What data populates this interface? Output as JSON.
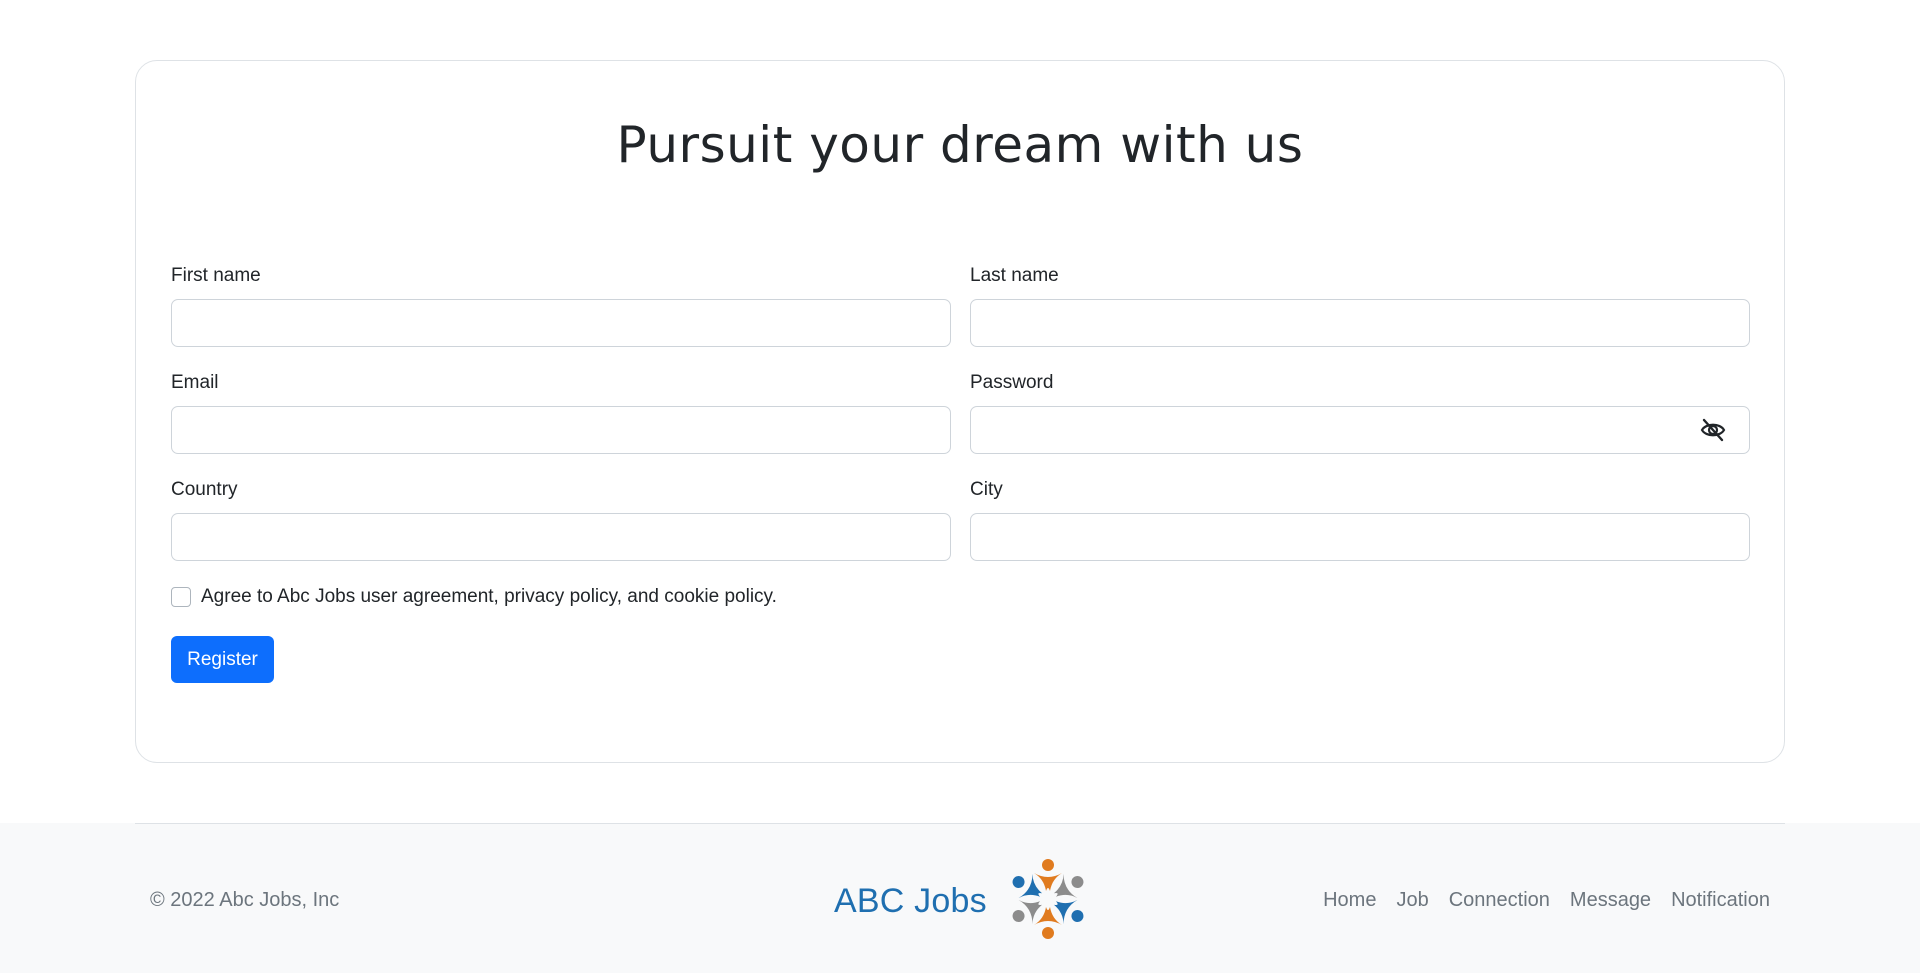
{
  "header": {
    "title": "Pursuit your dream with us"
  },
  "form": {
    "first_name_label": "First name",
    "last_name_label": "Last name",
    "email_label": "Email",
    "password_label": "Password",
    "country_label": "Country",
    "city_label": "City",
    "first_name_value": "",
    "last_name_value": "",
    "email_value": "",
    "password_value": "",
    "country_value": "",
    "city_value": "",
    "agree_label": "Agree to Abc Jobs user agreement, privacy policy, and cookie policy.",
    "agree_checked": false,
    "register_label": "Register",
    "password_toggle_icon": "eye-slash-icon"
  },
  "footer": {
    "copyright": "© 2022 Abc Jobs, Inc",
    "brand_text": "ABC Jobs",
    "brand_colors": [
      "#1f6fb0",
      "#e07b1f",
      "#8c8c8c"
    ],
    "nav": [
      "Home",
      "Job",
      "Connection",
      "Message",
      "Notification"
    ]
  },
  "colors": {
    "primary": "#0d6efd",
    "border": "#dee2e6",
    "footer_bg": "#f8f9fa",
    "muted_text": "#6c757d"
  }
}
